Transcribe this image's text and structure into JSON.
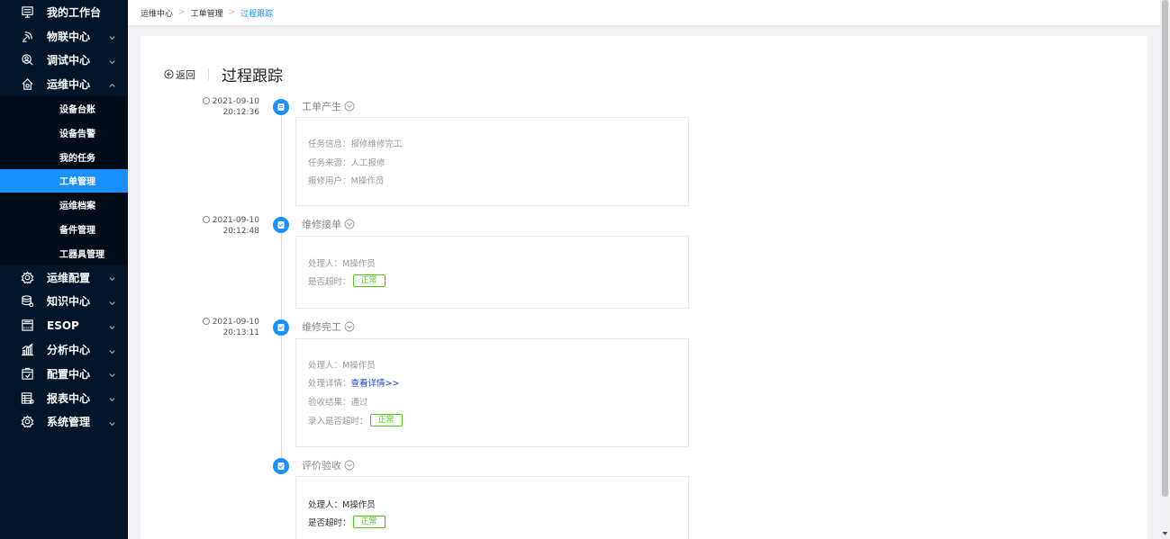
{
  "sidebar": {
    "items": [
      {
        "label": "我的工作台",
        "icon": "monitor-icon",
        "arrow": ""
      },
      {
        "label": "物联中心",
        "icon": "satellite-icon",
        "arrow": "down"
      },
      {
        "label": "调试中心",
        "icon": "user-search-icon",
        "arrow": "down"
      },
      {
        "label": "运维中心",
        "icon": "home-gear-icon",
        "arrow": "up"
      }
    ],
    "sub_items": [
      {
        "label": "设备台账",
        "active": false
      },
      {
        "label": "设备告警",
        "active": false
      },
      {
        "label": "我的任务",
        "active": false
      },
      {
        "label": "工单管理",
        "active": true
      },
      {
        "label": "运维档案",
        "active": false
      },
      {
        "label": "备件管理",
        "active": false
      },
      {
        "label": "工器具管理",
        "active": false
      }
    ],
    "items_after": [
      {
        "label": "运维配置",
        "icon": "config-gear-icon"
      },
      {
        "label": "知识中心",
        "icon": "knowledge-icon"
      },
      {
        "label": "ESOP",
        "icon": "esop-icon"
      },
      {
        "label": "分析中心",
        "icon": "chart-icon"
      },
      {
        "label": "配置中心",
        "icon": "box-icon"
      },
      {
        "label": "报表中心",
        "icon": "report-icon"
      },
      {
        "label": "系统管理",
        "icon": "settings-icon"
      }
    ]
  },
  "breadcrumb": {
    "items": [
      "运维中心",
      "工单管理",
      "过程跟踪"
    ]
  },
  "header": {
    "back_label": "返回",
    "title": "过程跟踪"
  },
  "timeline": [
    {
      "date": "2021-09-10",
      "time": "20:12:36",
      "title": "工单产生",
      "rows": [
        {
          "label": "任务信息：",
          "value": "报修维修完工"
        },
        {
          "label": "任务来源：",
          "value": "人工报修"
        },
        {
          "label": "报修用户：",
          "value": "M操作员"
        }
      ]
    },
    {
      "date": "2021-09-10",
      "time": "20:12:48",
      "title": "维修接单",
      "rows": [
        {
          "label": "处理人：",
          "value": "M操作员"
        },
        {
          "label": "是否超时：",
          "tag": "正常"
        }
      ]
    },
    {
      "date": "2021-09-10",
      "time": "20:13:11",
      "title": "维修完工",
      "rows": [
        {
          "label": "处理人：",
          "value": "M操作员"
        },
        {
          "label": "处理详情：",
          "link": "查看详情>>"
        },
        {
          "label": "验收结果：",
          "value": "通过"
        },
        {
          "label": "录入是否超时：",
          "tag": "正常"
        }
      ]
    },
    {
      "title": "评价验收",
      "rows": [
        {
          "label": "处理人：",
          "value": "M操作员"
        },
        {
          "label": "是否超时：",
          "tag": "正常"
        }
      ]
    }
  ]
}
